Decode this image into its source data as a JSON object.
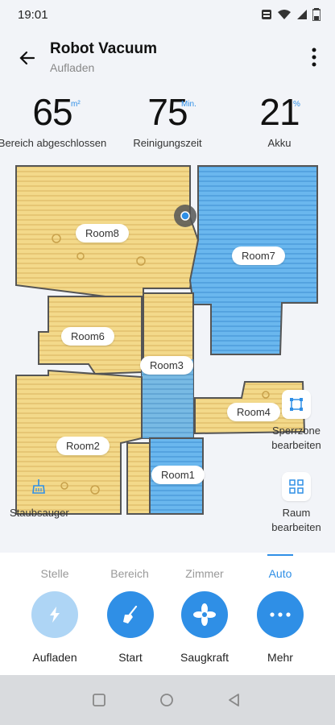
{
  "status_bar": {
    "time": "19:01"
  },
  "header": {
    "title": "Robot Vacuum",
    "subtitle": "Aufladen"
  },
  "stats": [
    {
      "value": "65",
      "unit": "m²",
      "label": "Bereich abgeschlossen"
    },
    {
      "value": "75",
      "unit": "Min.",
      "label": "Reinigungszeit"
    },
    {
      "value": "21",
      "unit": "%",
      "label": "Akku"
    }
  ],
  "rooms": [
    "Room8",
    "Room7",
    "Room6",
    "Room3",
    "Room4",
    "Room2",
    "Room1"
  ],
  "side_buttons": {
    "zone_edit": "Sperrzone bearbeiten",
    "vacuum": "Staubsauger",
    "room_edit": "Raum bearbeiten"
  },
  "tabs": [
    "Stelle",
    "Bereich",
    "Zimmer",
    "Auto"
  ],
  "active_tab": "Auto",
  "actions": [
    {
      "label": "Aufladen",
      "icon": "lightning-icon"
    },
    {
      "label": "Start",
      "icon": "broom-icon"
    },
    {
      "label": "Saugkraft",
      "icon": "fan-icon"
    },
    {
      "label": "Mehr",
      "icon": "more-icon"
    }
  ],
  "colors": {
    "accent": "#2f8fe6",
    "room_yellow": "#f3d98a",
    "room_blue": "#6ab7ee",
    "map_bg": "#f2f4f8"
  }
}
